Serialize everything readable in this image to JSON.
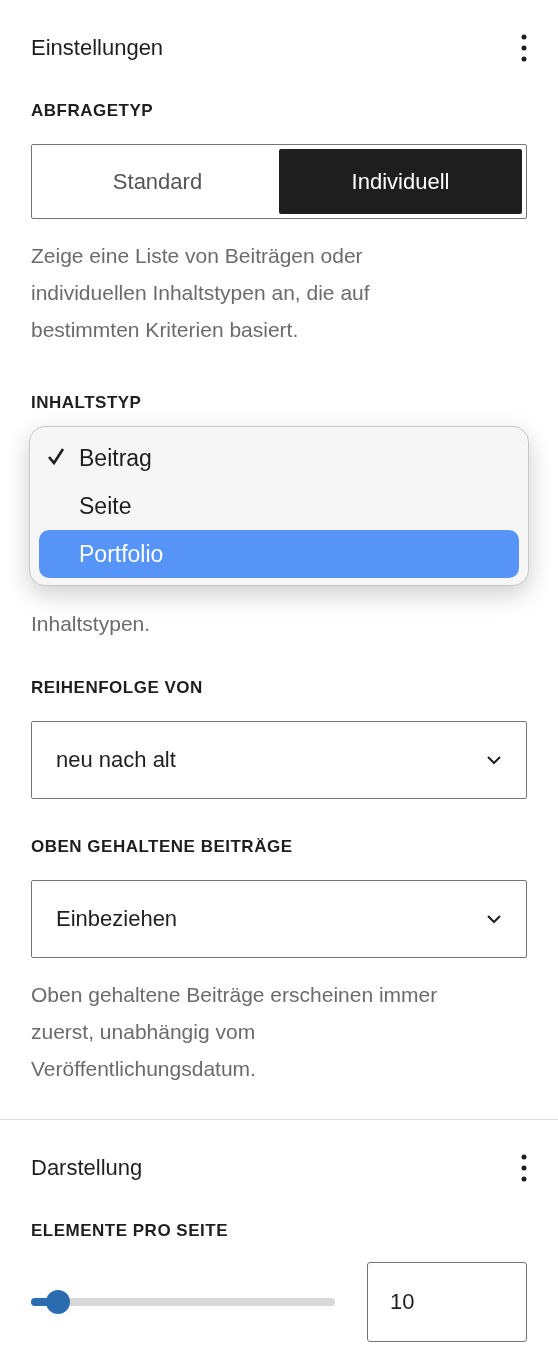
{
  "settings": {
    "title": "Einstellungen",
    "query_type": {
      "label": "ABFRAGETYP",
      "options": [
        {
          "label": "Standard",
          "selected": false
        },
        {
          "label": "Individuell",
          "selected": true
        }
      ],
      "help": "Zeige eine Liste von Beiträgen oder individuellen Inhaltstypen an, die auf bestimmten Kriterien basiert."
    },
    "content_type": {
      "label": "INHALTSTYP",
      "menu": [
        {
          "label": "Beitrag",
          "checked": true,
          "selected": false
        },
        {
          "label": "Seite",
          "checked": false,
          "selected": false
        },
        {
          "label": "Portfolio",
          "checked": false,
          "selected": true
        }
      ],
      "help": "Inhaltstypen."
    },
    "order": {
      "label": "REIHENFOLGE VON",
      "value": "neu nach alt"
    },
    "sticky": {
      "label": "OBEN GEHALTENE BEITRÄGE",
      "value": "Einbeziehen",
      "help": "Oben gehaltene Beiträge erscheinen immer zuerst, unabhängig vom Veröffentlichungsdatum."
    }
  },
  "display": {
    "title": "Darstellung",
    "per_page": {
      "label": "ELEMENTE PRO SEITE",
      "level": 0.09,
      "value": "10"
    }
  }
}
